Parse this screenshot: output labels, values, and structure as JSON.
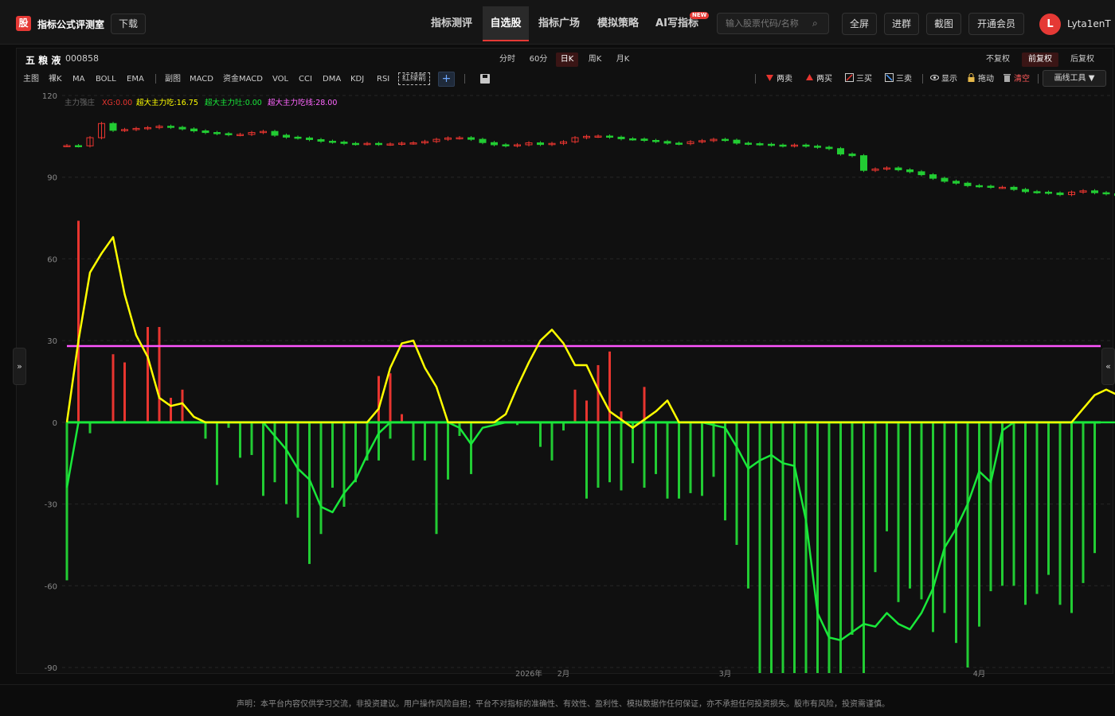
{
  "header": {
    "logo_char": "股",
    "app_title": "指标公式评测室",
    "download_label": "下载",
    "nav": [
      "指标测评",
      "自选股",
      "指标广场",
      "模拟策略",
      "AI写指标"
    ],
    "nav_active": 1,
    "new_badge": "NEW",
    "search_placeholder": "输入股票代码/名称",
    "buttons": [
      "全屏",
      "进群",
      "截图",
      "开通会员"
    ],
    "avatar_initial": "L",
    "username": "Lyta1enT"
  },
  "stock": {
    "name": "五 粮 液",
    "code": "000858"
  },
  "periods": [
    "分时",
    "60分",
    "日K",
    "周K",
    "月K"
  ],
  "period_active": 2,
  "adjust": [
    "不复权",
    "前复权",
    "后复权"
  ],
  "adjust_active": 1,
  "indicators_main": [
    "主图",
    "裸K",
    "MA",
    "BOLL",
    "EMA"
  ],
  "indicators_sub": [
    "副图",
    "MACD",
    "资金MACD",
    "VOL",
    "CCI",
    "DMA",
    "KDJ",
    "RSI"
  ],
  "indicator_boxed": "红绿箭",
  "tools": [
    "两卖",
    "两买",
    "三买",
    "三卖",
    "显示",
    "拖动",
    "清空"
  ],
  "draw_tool_label": "画线工具 ▼",
  "side_left": "»",
  "side_right": "«",
  "legend": {
    "title": "主力强庄",
    "xg": "XG:0.00",
    "super_eat": "超大主力吃:16.75",
    "super_spit": "超大主力吐:0.00",
    "super_line": "超大主力吃线:28.00"
  },
  "disclaimer": "声明：本平台内容仅供学习交流，非投资建议。用户操作风险自担；平台不对指标的准确性、有效性、盈利性、模拟数据作任何保证，亦不承担任何投资损失。股市有风险，投资需谨慎。",
  "colors": {
    "up": "#e8352f",
    "down": "#22cc33",
    "yellow": "#ffff00",
    "green_line": "#19e83a",
    "magenta": "#ff55ff",
    "accent": "#e53935"
  },
  "chart_data": {
    "type": "bar",
    "yticks": [
      120,
      90,
      60,
      30,
      0,
      -30,
      -60,
      -90
    ],
    "ylim": [
      -90,
      120
    ],
    "xlabels": [
      "2026年",
      "2月",
      "3月",
      "4月"
    ],
    "price_closes": [
      101.6,
      101.5,
      104.5,
      109.7,
      107.2,
      107.5,
      107.9,
      108.2,
      108.7,
      108.3,
      107.7,
      107.0,
      106.4,
      106.0,
      105.6,
      105.7,
      106.4,
      106.8,
      105.4,
      104.7,
      104.4,
      103.8,
      103.2,
      102.9,
      102.4,
      102.2,
      102.4,
      102.1,
      102.2,
      102.5,
      102.6,
      103.1,
      103.9,
      104.4,
      104.5,
      103.9,
      102.7,
      101.9,
      101.5,
      101.9,
      102.6,
      102.0,
      102.4,
      103.0,
      104.5,
      105.0,
      105.1,
      104.7,
      104.1,
      104.0,
      103.5,
      103.1,
      102.5,
      102.3,
      103.0,
      103.4,
      103.9,
      103.6,
      102.5,
      102.3,
      102.1,
      101.8,
      101.5,
      101.8,
      101.4,
      101.0,
      100.5,
      98.5,
      97.9,
      92.5,
      93.0,
      93.4,
      92.7,
      92.0,
      90.9,
      89.6,
      88.5,
      87.8,
      86.9,
      86.7,
      86.3,
      86.3,
      85.5,
      84.7,
      84.5,
      84.2,
      83.6,
      84.5,
      85.0,
      84.3,
      83.9,
      83.3,
      82.8,
      82.5,
      81.9,
      81.3,
      80.8,
      80.6,
      80.9,
      81.1,
      81.1,
      80.7,
      80.1
    ],
    "series": [
      {
        "name": "超大主力吃",
        "values": [
          0,
          74,
          0,
          0,
          25,
          22,
          0,
          35,
          35,
          9,
          12,
          0,
          0,
          0,
          0,
          0,
          0,
          0,
          0,
          0,
          0,
          0,
          0,
          0,
          0,
          0,
          0,
          17,
          18,
          3,
          0,
          0,
          0,
          0,
          0,
          0,
          0,
          0,
          0,
          0,
          0,
          0,
          0,
          0,
          12,
          8,
          21,
          26,
          4,
          0,
          13,
          0,
          0,
          0,
          0,
          0,
          0,
          0,
          0,
          0,
          0,
          0,
          0,
          0,
          0,
          0,
          0,
          0,
          0,
          0,
          0,
          0,
          0,
          0,
          0,
          0,
          0,
          0,
          0,
          0,
          0,
          0,
          0,
          0,
          0,
          0,
          0,
          0,
          0,
          0,
          0,
          0,
          0,
          0,
          0,
          0,
          0,
          0,
          0,
          0,
          0,
          0,
          0,
          7,
          5,
          0,
          0
        ]
      },
      {
        "name": "超大主力吐",
        "values": [
          -58,
          0,
          -4,
          0,
          0,
          0,
          0,
          0,
          0,
          0,
          0,
          0,
          -6,
          -23,
          -2,
          -13,
          -12,
          -27,
          -22,
          -30,
          -35,
          -52,
          -41,
          -24,
          -31,
          -22,
          -14,
          -14,
          -6,
          0,
          -14,
          -14,
          -41,
          -21,
          -5,
          -19,
          0,
          0,
          0,
          -1,
          0,
          -9,
          -14,
          -3,
          0,
          -28,
          -24,
          -22,
          -25,
          -15,
          -24,
          -19,
          -28,
          -28,
          -26,
          -27,
          -20,
          -36,
          -45,
          -61,
          -96,
          -96,
          -96,
          -96,
          -96,
          -96,
          -96,
          -96,
          -78,
          -96,
          -55,
          -40,
          -66,
          -61,
          -65,
          -77,
          -70,
          -81,
          -90,
          -75,
          -62,
          -60,
          -60,
          -67,
          -63,
          -56,
          -67,
          -70,
          -59,
          -48
        ]
      },
      {
        "name": "超大主力吃线",
        "values": [
          28
        ]
      },
      {
        "name": "黄线",
        "values": [
          0,
          30,
          55,
          62,
          68,
          47,
          32,
          24,
          9,
          6,
          7,
          2,
          0,
          0,
          0,
          0,
          0,
          0,
          0,
          0,
          0,
          0,
          0,
          0,
          0,
          0,
          0,
          5,
          20,
          29,
          30,
          20,
          13,
          0,
          0,
          0,
          0,
          0,
          3,
          13,
          22,
          30,
          34,
          29,
          21,
          21,
          12,
          4,
          1,
          -2,
          1,
          4,
          8,
          0,
          0,
          0,
          0,
          0,
          0,
          0,
          0,
          0,
          0,
          0,
          0,
          0,
          0,
          0,
          0,
          0,
          0,
          0,
          0,
          0,
          0,
          0,
          0,
          0,
          0,
          0,
          0,
          0,
          0,
          0,
          0,
          0,
          0,
          0,
          5,
          10,
          12,
          10,
          11,
          7,
          1,
          0,
          4,
          13,
          19,
          17
        ]
      },
      {
        "name": "绿线",
        "values": [
          -24,
          0,
          0,
          0,
          0,
          0,
          0,
          0,
          0,
          0,
          0,
          0,
          0,
          0,
          0,
          0,
          0,
          0,
          -5,
          -10,
          -17,
          -21,
          -31,
          -33,
          -26,
          -21,
          -12,
          -4,
          0,
          0,
          0,
          0,
          0,
          0,
          -2,
          -8,
          -2,
          -1,
          0,
          0,
          0,
          0,
          0,
          0,
          0,
          0,
          0,
          0,
          0,
          0,
          0,
          0,
          0,
          0,
          0,
          0,
          -1,
          -2,
          -9,
          -17,
          -14,
          -12,
          -15,
          -16,
          -36,
          -70,
          -79,
          -80,
          -77,
          -74,
          -75,
          -70,
          -74,
          -76,
          -70,
          -61,
          -46,
          -39,
          -30,
          -18,
          -22,
          -3,
          0,
          0,
          0,
          0,
          0,
          0,
          0,
          0,
          0,
          0,
          0,
          0,
          0,
          0,
          0,
          0,
          0,
          0,
          0,
          0
        ]
      }
    ]
  }
}
